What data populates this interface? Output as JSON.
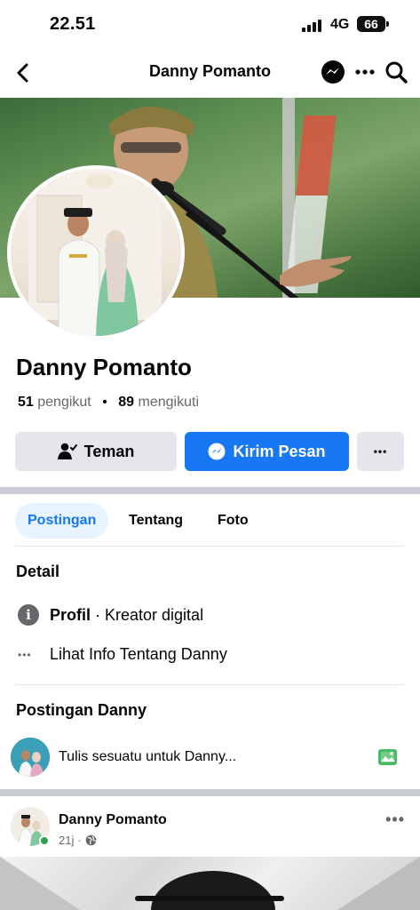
{
  "status": {
    "time": "22.51",
    "network": "4G",
    "battery": "66"
  },
  "nav": {
    "title": "Danny Pomanto",
    "back_icon": "chevron-left-icon",
    "messenger_icon": "messenger-icon",
    "more_icon": "more-horizontal-icon",
    "search_icon": "search-icon"
  },
  "profile": {
    "name": "Danny Pomanto",
    "followers_count": "51",
    "followers_label": "pengikut",
    "separator": "•",
    "following_count": "89",
    "following_label": "mengikuti"
  },
  "actions": {
    "friend_label": "Teman",
    "message_label": "Kirim Pesan",
    "more_label": "•••"
  },
  "tabs": [
    {
      "label": "Postingan",
      "active": true
    },
    {
      "label": "Tentang",
      "active": false
    },
    {
      "label": "Foto",
      "active": false
    }
  ],
  "detail": {
    "title": "Detail",
    "profile_bold": "Profil",
    "profile_rest": " · Kreator digital",
    "info_more_icon": "•••",
    "info_more": "Lihat Info Tentang Danny"
  },
  "posts_section": {
    "title": "Postingan Danny",
    "composer_placeholder": "Tulis sesuatu untuk Danny..."
  },
  "post": {
    "author": "Danny Pomanto",
    "time": "21j",
    "dot": "·",
    "more": "•••"
  },
  "colors": {
    "accent": "#1877f2",
    "tab_active_bg": "#e7f3ff",
    "online": "#31a24c",
    "secondary_text": "#65676b"
  }
}
